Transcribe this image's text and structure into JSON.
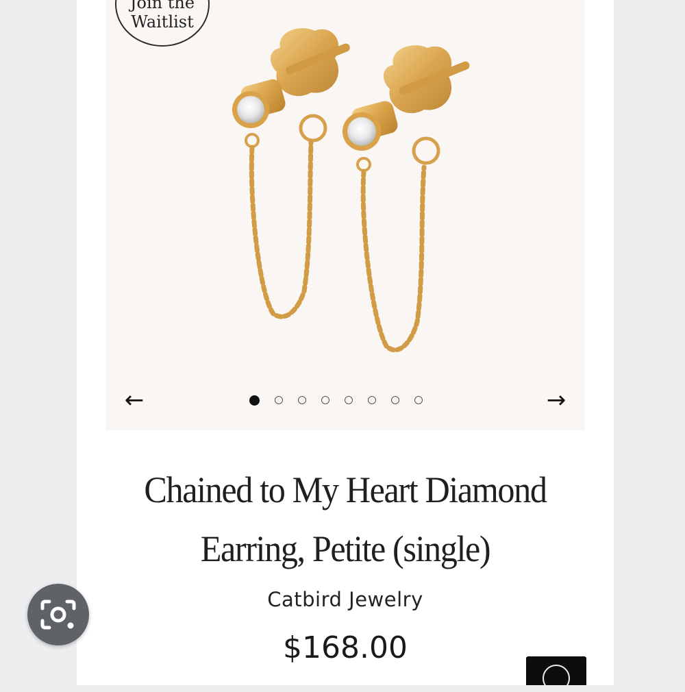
{
  "badge": {
    "line1": "Join the",
    "line2": "Waitlist"
  },
  "carousel": {
    "prev_arrow": "←",
    "next_arrow": "→",
    "slide_count": 8,
    "active_index": 0
  },
  "product": {
    "title_line1": "Chained to My Heart Diamond",
    "title_line2": "Earring, Petite (single)",
    "brand": "Catbird Jewelry",
    "price": "$168.00"
  },
  "icons": {
    "lens": "google-lens-icon",
    "prev": "arrow-left-icon",
    "next": "arrow-right-icon"
  },
  "colors": {
    "gold": "#d8a24a",
    "hero_bg": "#faf6f3",
    "page_bg": "#edeef0",
    "fab": "#5f6368"
  }
}
